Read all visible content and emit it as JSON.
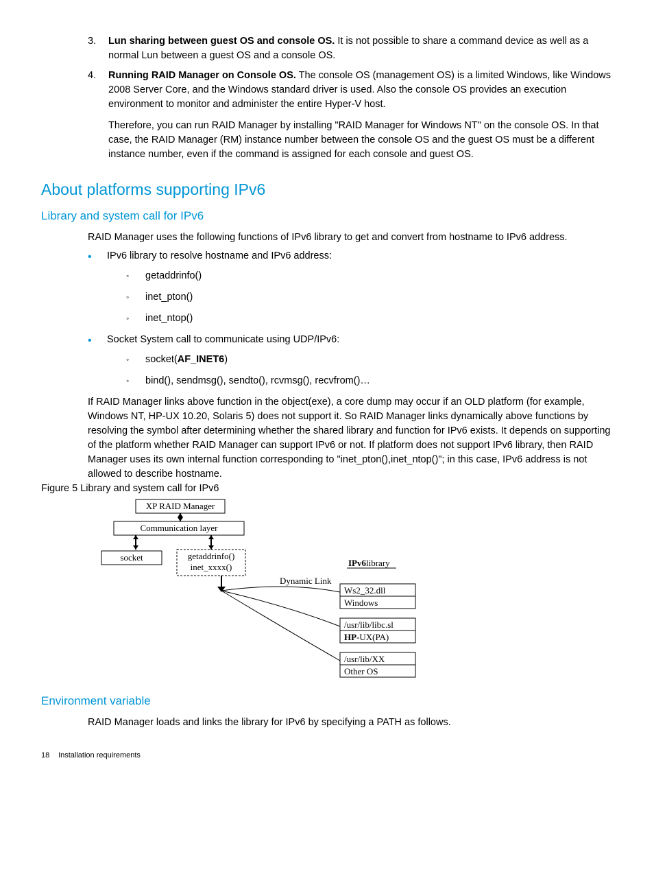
{
  "list3": {
    "num": "3.",
    "bold": "Lun sharing between guest OS and console OS.",
    "text": " It is not possible to share a command device as well as a normal Lun between a guest OS and a console OS."
  },
  "list4": {
    "num": "4.",
    "bold": "Running RAID Manager on Console OS.",
    "text": " The console OS (management OS) is a limited Windows, like Windows 2008 Server Core, and the Windows standard driver is used. Also the console OS provides an execution environment to monitor and administer the entire Hyper-V host."
  },
  "list4b": "Therefore, you can run RAID Manager by installing \"RAID Manager for Windows NT\" on the console OS. In that case, the RAID Manager (RM) instance number between the console OS and the guest OS must be a different instance number, even if the command is assigned for each console and guest OS.",
  "h2": "About platforms supporting IPv6",
  "h3a": "Library and system call for IPv6",
  "p1": "RAID Manager uses the following functions of IPv6 library to get and convert from hostname to IPv6 address.",
  "b1": "IPv6 library to resolve hostname and IPv6 address:",
  "b1a": "getaddrinfo()",
  "b1b": "inet_pton()",
  "b1c": "inet_ntop()",
  "b2": "Socket System call to communicate using UDP/IPv6:",
  "b2a_pre": "socket(",
  "b2a_bold": "AF_INET6",
  "b2a_post": ")",
  "b2b": "bind(), sendmsg(), sendto(), rcvmsg(), recvfrom()…",
  "p2": "If RAID Manager links above function in the object(exe), a core dump may occur if an OLD platform (for example, Windows NT, HP-UX 10.20, Solaris 5) does not support it. So RAID Manager links dynamically above functions by resolving the symbol after determining whether the shared library and function for IPv6 exists. It depends on supporting of the platform whether RAID Manager can support IPv6 or not. If platform does not support IPv6 library, then RAID Manager uses its own internal function corresponding to \"inet_pton(),inet_ntop()\"; in this case, IPv6 address is not allowed to describe hostname.",
  "figcap": "Figure 5 Library and system call for IPv6",
  "diag": {
    "box_rm": "XP RAID Manager",
    "box_comm": "Communication layer",
    "box_socket": "socket",
    "box_getaddr": "getaddrinfo()",
    "box_inetx": "inet_xxxx()",
    "lbl_dynlink": "Dynamic Link",
    "lbl_ipv6_pre": "IPv6",
    "lbl_ipv6_post": "library",
    "box_ws2": "Ws2_32.dll",
    "box_win": "Windows",
    "box_libc": "/usr/lib/libc.sl",
    "box_hp_pre": "HP",
    "box_hp_post": "-UX(PA)",
    "box_xx": "/usr/lib/XX",
    "box_other": "Other OS"
  },
  "h3b": "Environment variable",
  "p3": "RAID Manager loads and links the library for IPv6 by specifying a PATH as follows.",
  "footer_page": "18",
  "footer_title": "Installation requirements"
}
